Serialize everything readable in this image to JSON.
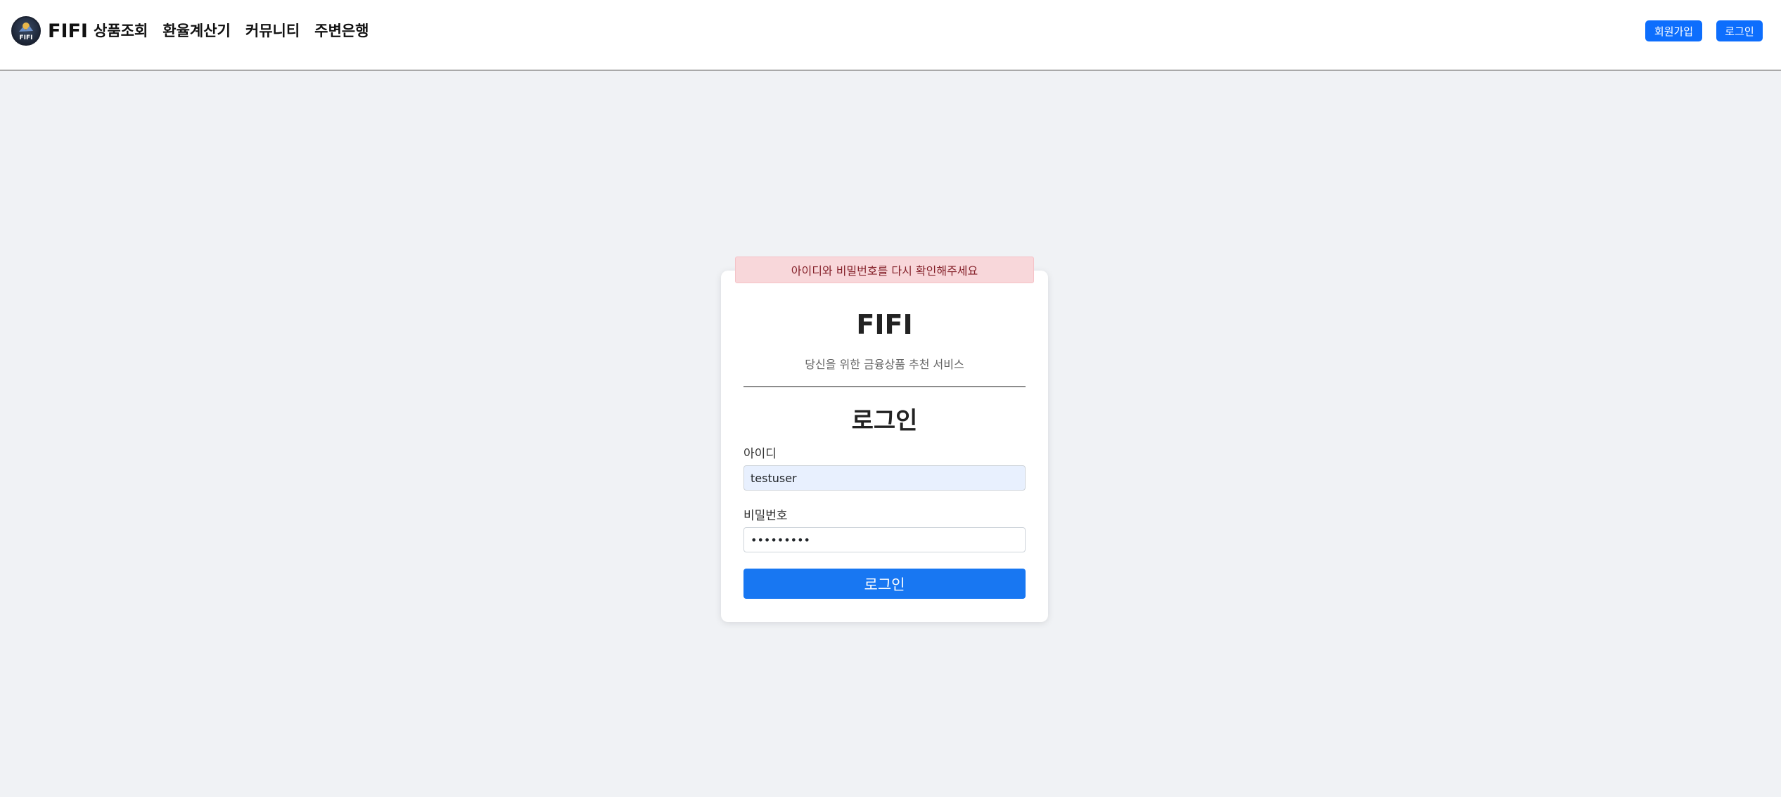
{
  "navbar": {
    "brand": "FIFI",
    "logo_text": "FIFI",
    "links": [
      "상품조회",
      "환율계산기",
      "커뮤니티",
      "주변은행"
    ],
    "signup_label": "회원가입",
    "login_label": "로그인"
  },
  "alert": {
    "message": "아이디와 비밀번호를 다시 확인해주세요"
  },
  "login_card": {
    "title": "FIFI",
    "subtitle": "당신을 위한 금융상품 추천 서비스",
    "heading": "로그인",
    "username_label": "아이디",
    "username_value": "testuser",
    "password_label": "비밀번호",
    "password_value": "password1",
    "submit_label": "로그인"
  },
  "colors": {
    "primary": "#0d6efd",
    "login_button": "#1877f2",
    "alert_bg": "#f8d7da",
    "alert_text": "#842029",
    "page_bg": "#f0f2f5"
  }
}
